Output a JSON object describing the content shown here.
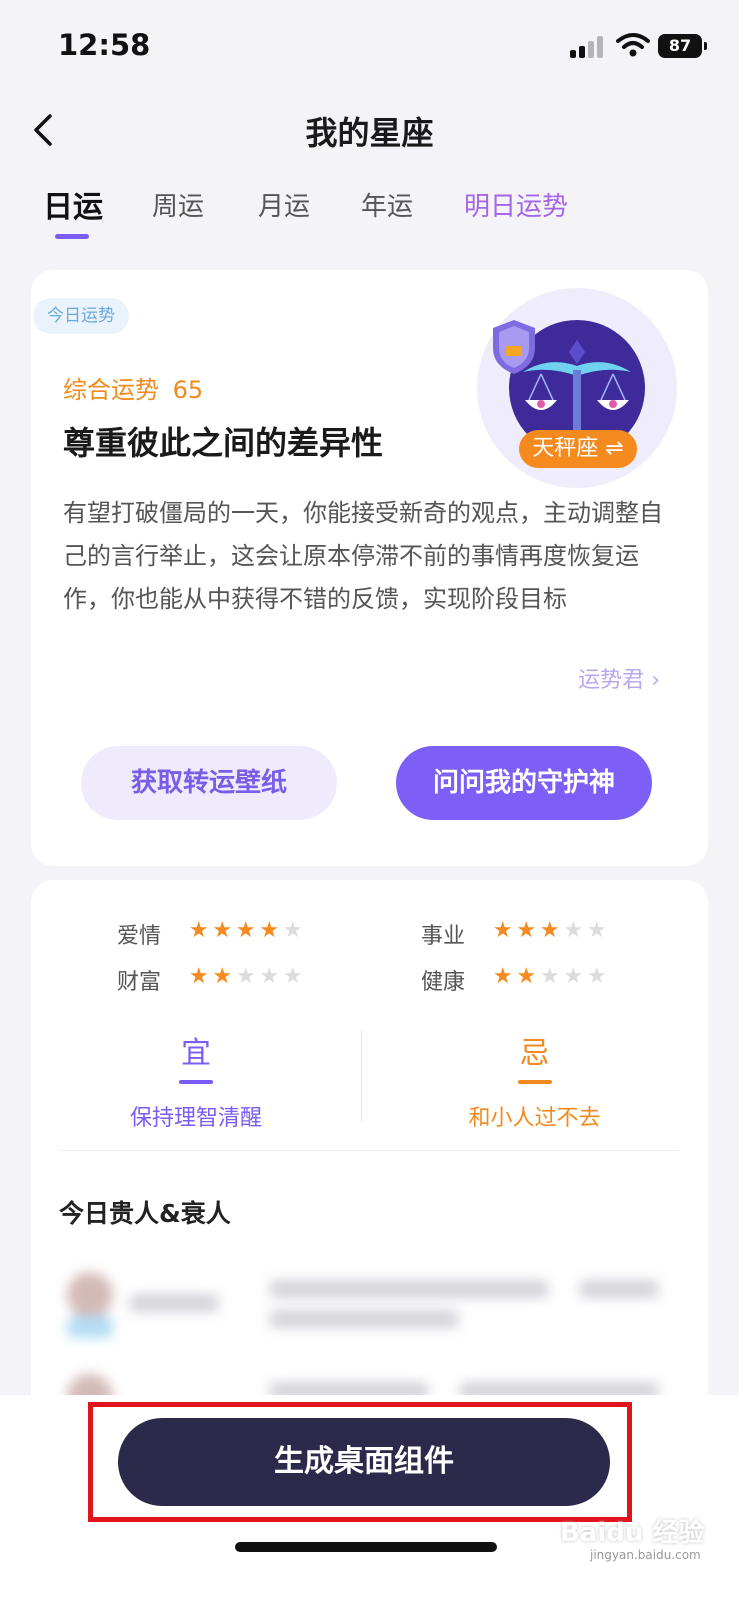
{
  "status_bar": {
    "time": "12:58",
    "battery": "87"
  },
  "nav": {
    "title": "我的星座"
  },
  "tabs": [
    {
      "label": "日运"
    },
    {
      "label": "周运"
    },
    {
      "label": "月运"
    },
    {
      "label": "年运"
    },
    {
      "label": "明日运势"
    }
  ],
  "fortune_card": {
    "badge": "今日运势",
    "score_label": "综合运势",
    "score": "65",
    "headline": "尊重彼此之间的差异性",
    "description": "有望打破僵局的一天，你能接受新奇的观点，主动调整自己的言行举止，这会让原本停滞不前的事情再度恢复运作，你也能从中获得不错的反馈，实现阶段目标",
    "helper_link": "运势君",
    "zodiac_sign": "天秤座",
    "wallpaper_button": "获取转运壁纸",
    "guardian_button": "问问我的守护神"
  },
  "ratings": [
    {
      "label": "爱情",
      "stars": 4,
      "max": 5
    },
    {
      "label": "事业",
      "stars": 3,
      "max": 5
    },
    {
      "label": "财富",
      "stars": 2,
      "max": 5
    },
    {
      "label": "健康",
      "stars": 2,
      "max": 5
    }
  ],
  "yi": {
    "title": "宜",
    "text": "保持理智清醒"
  },
  "ji": {
    "title": "忌",
    "text": "和小人过不去"
  },
  "nobles_title": "今日贵人&衰人",
  "bottom": {
    "create_widget_button": "生成桌面组件"
  },
  "watermark": {
    "brand": "Baidu 经验",
    "url": "jingyan.baidu.com"
  },
  "colors": {
    "accent": "#7b5cf5",
    "orange": "#f28a1e",
    "button_dark": "#2c2a4a",
    "highlight_red": "#e2141b"
  }
}
